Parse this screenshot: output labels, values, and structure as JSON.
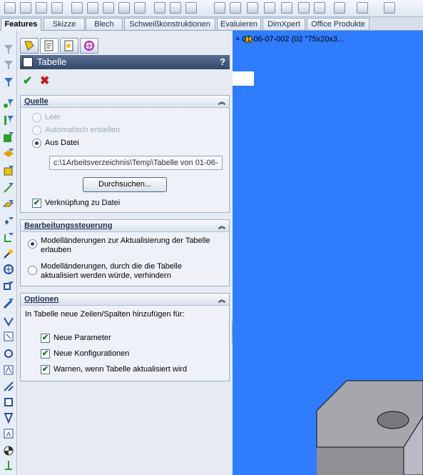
{
  "tabs": [
    "Features",
    "Skizze",
    "Blech",
    "Schweißkonstruktionen",
    "Evaluieren",
    "DimXpert",
    "Office Produkte"
  ],
  "active_tab": "Features",
  "panel_tabs": [
    "feature-manager-icon",
    "property-manager-icon",
    "configuration-manager-icon",
    "display-manager-icon"
  ],
  "title": "Tabelle",
  "help_label": "?",
  "ok_icon": "✔",
  "cancel_icon": "✖",
  "sections": {
    "quelle": {
      "title": "Quelle",
      "options": [
        {
          "label": "Leer",
          "checked": false,
          "disabled": true
        },
        {
          "label": "Automatisch erstellen",
          "checked": false,
          "disabled": true
        },
        {
          "label": "Aus Datei",
          "checked": true,
          "disabled": false
        }
      ],
      "file_path": "c:\\1Arbeitsverzeichnis\\Temp\\Tabelle von 01-06-",
      "browse_label": "Durchsuchen...",
      "link_label": "Verknüpfung zu Datei",
      "link_checked": true
    },
    "bearbeitung": {
      "title": "Bearbeitungssteuerung",
      "option1_line1": "Modelländerungen zur Aktualisierung der Tabelle",
      "option1_line2": "erlauben",
      "option2_line1": "Modelländerungen, durch die die Tabelle",
      "option2_line2": "aktualisiert werden würde, verhindern",
      "selected": 1
    },
    "optionen": {
      "title": "Optionen",
      "description": "In Tabelle neue Zeilen/Spalten hinzufügen für:",
      "checks": [
        {
          "label": "Neue Parameter",
          "checked": true
        },
        {
          "label": "Neue Konfigurationen",
          "checked": true
        },
        {
          "label": "Warnen, wenn Tabelle aktualisiert wird",
          "checked": true
        }
      ]
    }
  },
  "viewport": {
    "tree_item": "+ 01-06-07-002  (02 \"75x20x3...",
    "background_color": "#2f7cff"
  },
  "colors": {
    "title_bar": "#3f5479",
    "panel_bg": "#e6ebf3",
    "ok": "#1f9e1f",
    "cancel": "#c81818"
  }
}
